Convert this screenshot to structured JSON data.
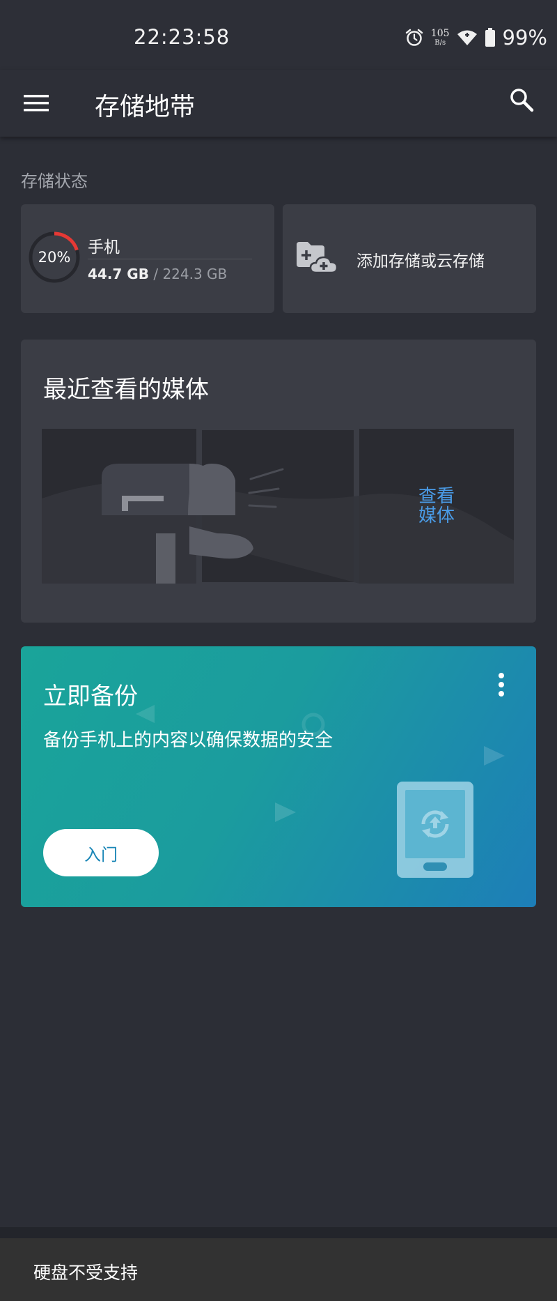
{
  "status_bar": {
    "time": "22:23:58",
    "net_speed_value": "105",
    "net_speed_unit": "B/s",
    "battery_percent": "99%",
    "icons": [
      "alarm-icon",
      "wifi-icon",
      "battery-icon"
    ]
  },
  "app_bar": {
    "title": "存储地带",
    "icons": [
      "menu-icon",
      "search-icon"
    ]
  },
  "storage_status": {
    "section_label": "存储状态",
    "phone": {
      "usage_percent": 20,
      "usage_percent_label": "20%",
      "name": "手机",
      "used": "44.7 GB",
      "separator": "/",
      "total": "224.3 GB"
    },
    "add_storage": {
      "label": "添加存储或云存储",
      "icon": "add-folder-cloud-icon"
    }
  },
  "recent_media": {
    "title": "最近查看的媒体",
    "view_media_label": "查看\n媒体"
  },
  "backup": {
    "title": "立即备份",
    "description": "备份手机上的内容以确保数据的安全",
    "button_label": "入门",
    "icons": [
      "more-vert-icon",
      "tablet-sync-icon"
    ]
  },
  "toast": {
    "message": "硬盘不受支持"
  },
  "colors": {
    "background": "#2c2e36",
    "card": "#3b3d45",
    "accent_link": "#4a9be6",
    "progress_ring": "#e53935",
    "backup_gradient_start": "#1aa49a",
    "backup_gradient_end": "#1d7eb8"
  }
}
